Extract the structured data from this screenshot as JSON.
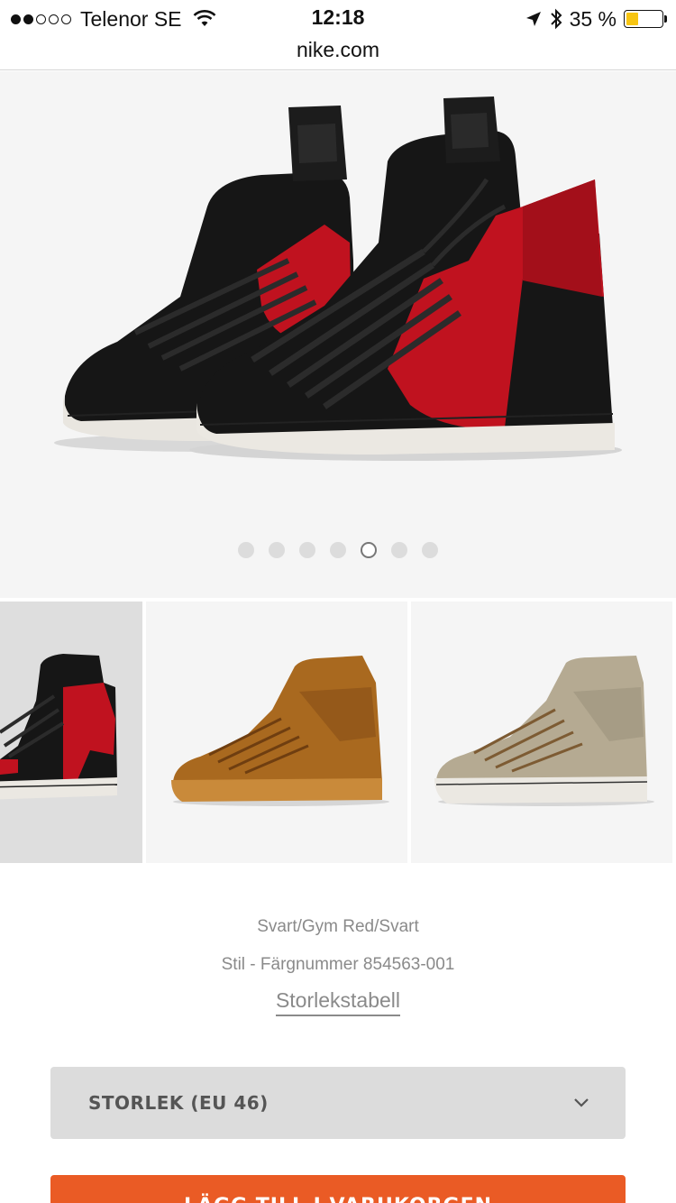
{
  "status_bar": {
    "carrier": "Telenor SE",
    "time": "12:18",
    "battery_percent": "35 %",
    "battery_level": 0.35
  },
  "browser": {
    "url": "nike.com"
  },
  "gallery": {
    "page_count": 7,
    "active_index": 4
  },
  "product": {
    "color_name": "Svart/Gym Red/Svart",
    "style_code": "Stil - Färgnummer 854563-001",
    "size_chart_link": "Storlekstabell"
  },
  "size_select": {
    "selected_value": "STORLEK (EU 46)"
  },
  "cta": {
    "label": "LÄGG TILL I VARUKORGEN"
  },
  "colors": {
    "accent": "#ea5b25",
    "battery": "#f7c512",
    "shoe_red": "#c0121f",
    "shoe_black": "#161616"
  }
}
